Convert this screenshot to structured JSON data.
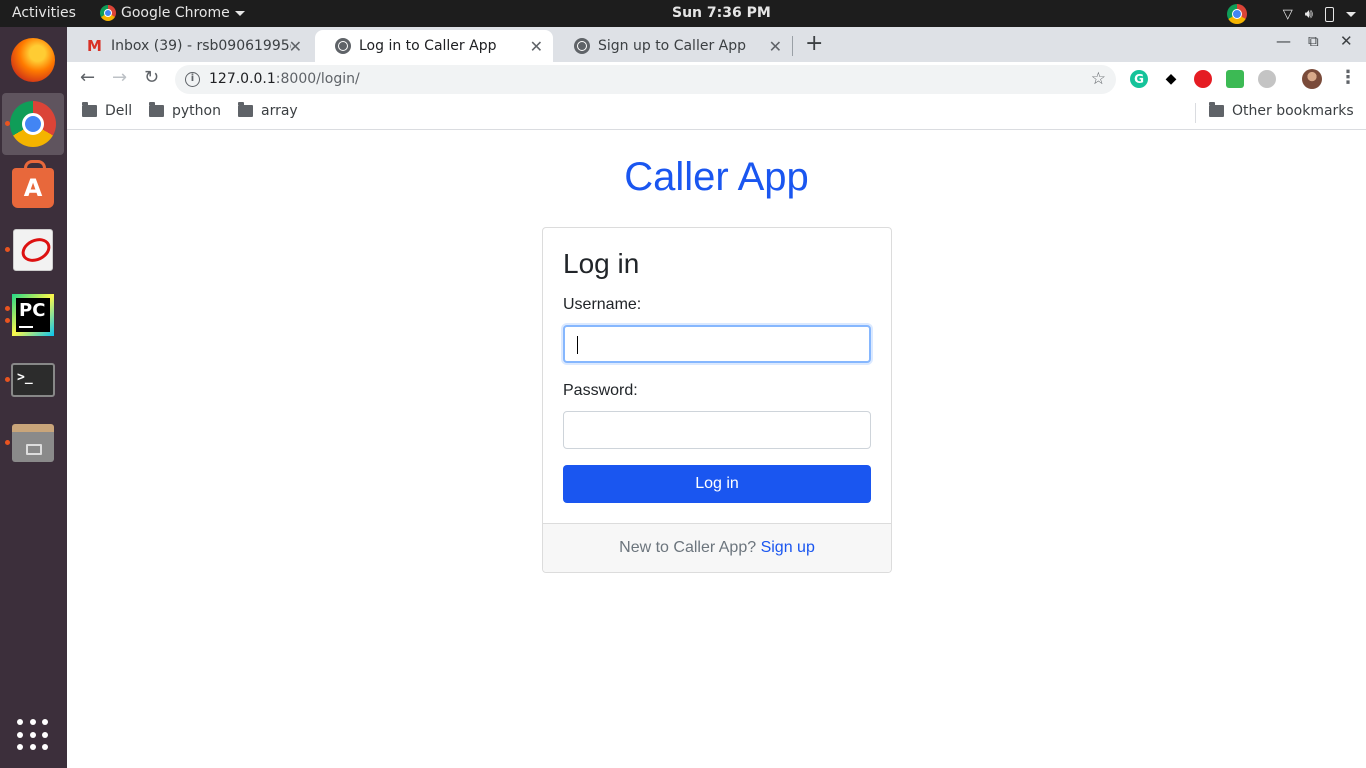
{
  "system": {
    "activities": "Activities",
    "app_menu": "Google Chrome",
    "clock": "Sun  7:36 PM"
  },
  "dock": {
    "items": [
      "firefox-icon",
      "chrome-icon",
      "software-center-icon",
      "pdf-viewer-icon",
      "pycharm-icon",
      "terminal-icon",
      "files-icon"
    ],
    "pycharm_label": "PC",
    "terminal_label": ">_",
    "software_label": "A"
  },
  "browser": {
    "tabs": [
      {
        "title": "Inbox (39) - rsb09061995@",
        "icon": "gmail-icon",
        "active": false
      },
      {
        "title": "Log in to Caller App",
        "icon": "globe-icon",
        "active": true
      },
      {
        "title": "Sign up to Caller App",
        "icon": "globe-icon",
        "active": false
      }
    ],
    "address": {
      "host": "127.0.0.1",
      "rest": ":8000/login/"
    },
    "bookmarks": [
      "Dell",
      "python",
      "array"
    ],
    "other_bookmarks": "Other bookmarks",
    "extensions": {
      "grammarly": "G"
    }
  },
  "page": {
    "app_title": "Caller App",
    "heading": "Log in",
    "username_label": "Username:",
    "username_value": "",
    "password_label": "Password:",
    "password_value": "",
    "login_button": "Log in",
    "footer_text": "New to Caller App?",
    "signup_link": "Sign up"
  },
  "colors": {
    "accent": "#1a56f0",
    "dock": "#3c2f3b",
    "topbar": "#1d1d1d"
  }
}
